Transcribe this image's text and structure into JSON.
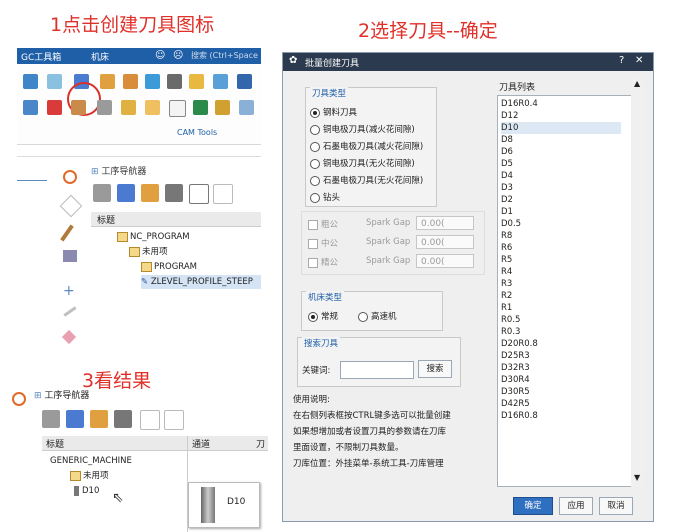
{
  "steps": {
    "step1": "1点击创建刀具图标",
    "step2": "2选择刀具--确定",
    "step3": "3看结果"
  },
  "panel1": {
    "tab_gc": "GC工具箱",
    "tab_machine": "机床",
    "search_placeholder": "搜索 (Ctrl+Space",
    "cam_tools": "CAM Tools",
    "navigator_title": "工序导航器",
    "tree_header": "标题",
    "tree": [
      "NC_PROGRAM",
      "未用项",
      "PROGRAM",
      "ZLEVEL_PROFILE_STEEP"
    ]
  },
  "panel3": {
    "navigator_title": "工序导航器",
    "col_title": "标题",
    "col_channel": "通道",
    "col_tool_partial": "刀",
    "tree": [
      "GENERIC_MACHINE",
      "未用项",
      "D10"
    ],
    "tooltip": "D10"
  },
  "dialog": {
    "title": "批量创建刀具",
    "help": "?",
    "close": "✕",
    "tool_type_legend": "刀具类型",
    "tool_types": [
      "钢料刀具",
      "铜电极刀具(减火花间隙)",
      "石墨电极刀具(减火花间隙)",
      "铜电极刀具(无火花间隙)",
      "石墨电极刀具(无火花间隙)",
      "钻头"
    ],
    "tool_type_selected": 0,
    "gap_rows": [
      {
        "label": "粗公",
        "field": "Spark Gap",
        "value": "0.00("
      },
      {
        "label": "中公",
        "field": "Spark Gap",
        "value": "0.00("
      },
      {
        "label": "精公",
        "field": "Spark Gap",
        "value": "0.00("
      }
    ],
    "machine_legend": "机床类型",
    "machine_types": [
      "常规",
      "高速机"
    ],
    "machine_selected": 0,
    "search_legend": "搜索刀具",
    "keyword_label": "关键词:",
    "search_button": "搜索",
    "instructions": [
      "使用说明:",
      "在右侧列表框按CTRL键多选可以批量创建",
      "如果想增加或者设置刀具的参数请在刀库",
      "里面设置，不限制刀具数量。",
      "刀库位置：外挂菜单-系统工具-刀库管理"
    ],
    "list_title": "刀具列表",
    "tools": [
      "D16R0.4",
      "D12",
      "D10",
      "D8",
      "D6",
      "D5",
      "D4",
      "D3",
      "D2",
      "D1",
      "D0.5",
      "R8",
      "R6",
      "R5",
      "R4",
      "R3",
      "R2",
      "R1",
      "R0.5",
      "R0.3",
      "D20R0.8",
      "D25R3",
      "D32R3",
      "D30R4",
      "D30R5",
      "D42R5",
      "D16R0.8"
    ],
    "tool_selected": 2,
    "ok_button": "确定",
    "apply_button": "应用",
    "cancel_button": "取消"
  },
  "colors": {
    "accent_red": "#e0302a",
    "title_blue": "#1f5fa8",
    "dialog_title_bg": "#2b3a4e",
    "ok_button_bg": "#2f6fc0"
  }
}
